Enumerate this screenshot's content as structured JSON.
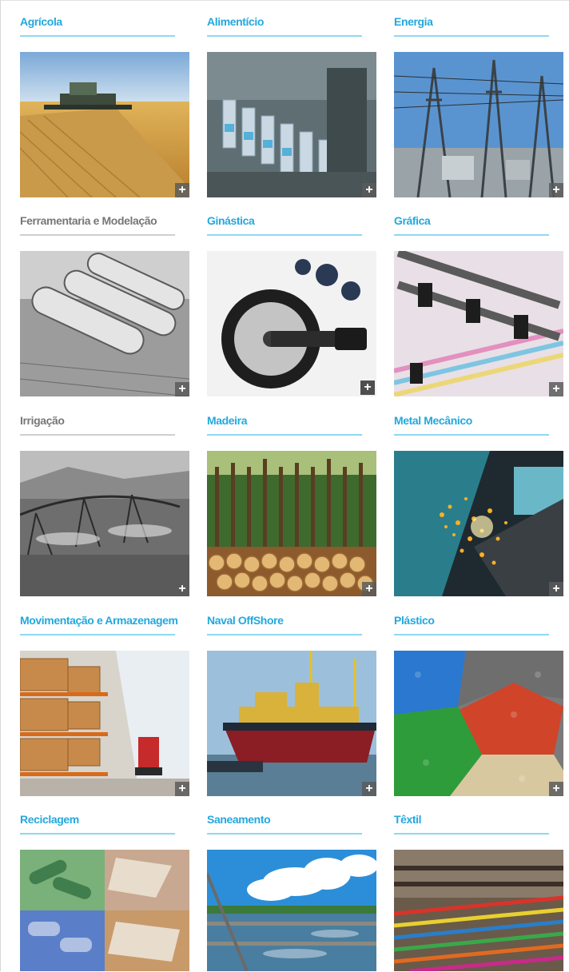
{
  "sectors": [
    {
      "label": "Agrícola",
      "title_color": "#23a8dd",
      "image": "wheat-harvester"
    },
    {
      "label": "Alimentício",
      "title_color": "#23a8dd",
      "image": "bottling-line"
    },
    {
      "label": "Energia",
      "title_color": "#23a8dd",
      "image": "power-substation"
    },
    {
      "label": "Ferramentaria e Modelação",
      "title_color": "#777777",
      "image": "machined-rollers"
    },
    {
      "label": "Ginástica",
      "title_color": "#23a8dd",
      "image": "weight-plates"
    },
    {
      "label": "Gráfica",
      "title_color": "#23a8dd",
      "image": "printing-press"
    },
    {
      "label": "Irrigação",
      "title_color": "#777777",
      "image": "irrigation-pivot"
    },
    {
      "label": "Madeira",
      "title_color": "#23a8dd",
      "image": "timber-logs"
    },
    {
      "label": "Metal Mecânico",
      "title_color": "#23a8dd",
      "image": "welding-sparks"
    },
    {
      "label": "Movimentação e Armazenagem",
      "title_color": "#23a8dd",
      "image": "warehouse-racks"
    },
    {
      "label": "Naval OffShore",
      "title_color": "#23a8dd",
      "image": "offshore-platform"
    },
    {
      "label": "Plástico",
      "title_color": "#23a8dd",
      "image": "plastic-pellets"
    },
    {
      "label": "Reciclagem",
      "title_color": "#23a8dd",
      "image": "recycling-materials"
    },
    {
      "label": "Saneamento",
      "title_color": "#23a8dd",
      "image": "water-treatment"
    },
    {
      "label": "Têxtil",
      "title_color": "#23a8dd",
      "image": "textile-machine"
    }
  ],
  "more_badge": "+"
}
